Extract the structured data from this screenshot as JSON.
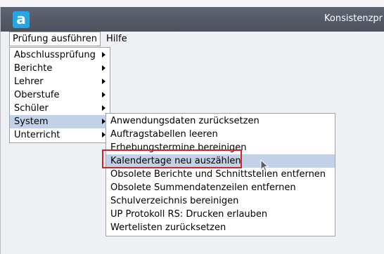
{
  "window": {
    "title": "Konsistenzpr",
    "logo_letter": "a"
  },
  "menubar": [
    {
      "label": "Prüfung ausführen",
      "open": true
    },
    {
      "label": "Hilfe",
      "open": false
    }
  ],
  "menu": {
    "items": [
      {
        "label": "Abschlussprüfung",
        "submenu": true
      },
      {
        "label": "Berichte",
        "submenu": true
      },
      {
        "label": "Lehrer",
        "submenu": true
      },
      {
        "label": "Oberstufe",
        "submenu": true
      },
      {
        "label": "Schüler",
        "submenu": true
      },
      {
        "label": "System",
        "submenu": true,
        "highlighted": true
      },
      {
        "label": "Unterricht",
        "submenu": true
      }
    ]
  },
  "submenu": {
    "items": [
      {
        "label": "Anwendungsdaten zurücksetzen"
      },
      {
        "label": "Auftragstabellen leeren"
      },
      {
        "label": "Erhebungstermine bereinigen"
      },
      {
        "label": "Kalendertage neu auszählen",
        "highlighted": true,
        "marked": true
      },
      {
        "label": "Obsolete Berichte und Schnittstellen entfernen"
      },
      {
        "label": "Obsolete Summendatenzeilen entfernen"
      },
      {
        "label": "Schulverzeichnis bereinigen"
      },
      {
        "label": "UP Protokoll RS: Drucken erlauben"
      },
      {
        "label": "Wertelisten zurücksetzen"
      }
    ]
  },
  "colors": {
    "titlebar": "#4b515d",
    "highlight": "#c1d2e8",
    "marker": "#d62424",
    "logo": "#26a5e4"
  }
}
